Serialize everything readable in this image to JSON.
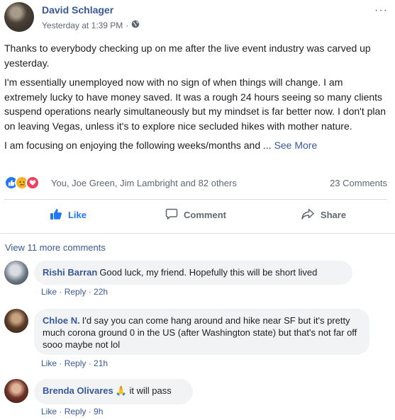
{
  "post": {
    "author": "David Schlager",
    "timestamp": "Yesterday at 1:39 PM",
    "meta_separator": "·",
    "privacy_icon": "globe-icon",
    "more_icon": "···",
    "body": [
      "Thanks to everybody checking up on me after the live event industry was carved up yesterday.",
      "I'm essentially unemployed now with no sign of when things will change. I am extremely lucky to have money saved. It was a rough 24 hours seeing so many clients suspend operations nearly simultaneously but my mindset is far better now. I don't plan on leaving Vegas, unless it's to explore nice secluded hikes with mother nature.",
      "I am focusing on enjoying the following weeks/months and ..."
    ],
    "see_more": "See More"
  },
  "reactions": {
    "types": [
      "like",
      "sad",
      "love"
    ],
    "names": "You, Joe Green, Jim Lambright and 82 others",
    "comment_count": "23 Comments"
  },
  "actions": {
    "like": "Like",
    "comment": "Comment",
    "share": "Share"
  },
  "view_more_comments": "View 11 more comments",
  "comments": [
    {
      "name": "Rishi Barran",
      "text": "Good luck, my friend. Hopefully this will be short lived",
      "like": "Like",
      "reply": "Reply",
      "time": "22h"
    },
    {
      "name": "Chloe N.",
      "text": "I'd say you can come hang around and hike near SF but it's pretty much corona ground 0 in the US (after Washington state) but that's not far off sooo maybe not lol",
      "like": "Like",
      "reply": "Reply",
      "time": "21h"
    },
    {
      "name": "Brenda Olivares",
      "emoji": "🙏",
      "text": "it will pass",
      "like": "Like",
      "reply": "Reply",
      "time": "9h"
    }
  ],
  "colors": {
    "link": "#385898",
    "like_blue": "#2078f4",
    "secondary_text": "#606770",
    "bubble_bg": "#f2f3f5"
  }
}
